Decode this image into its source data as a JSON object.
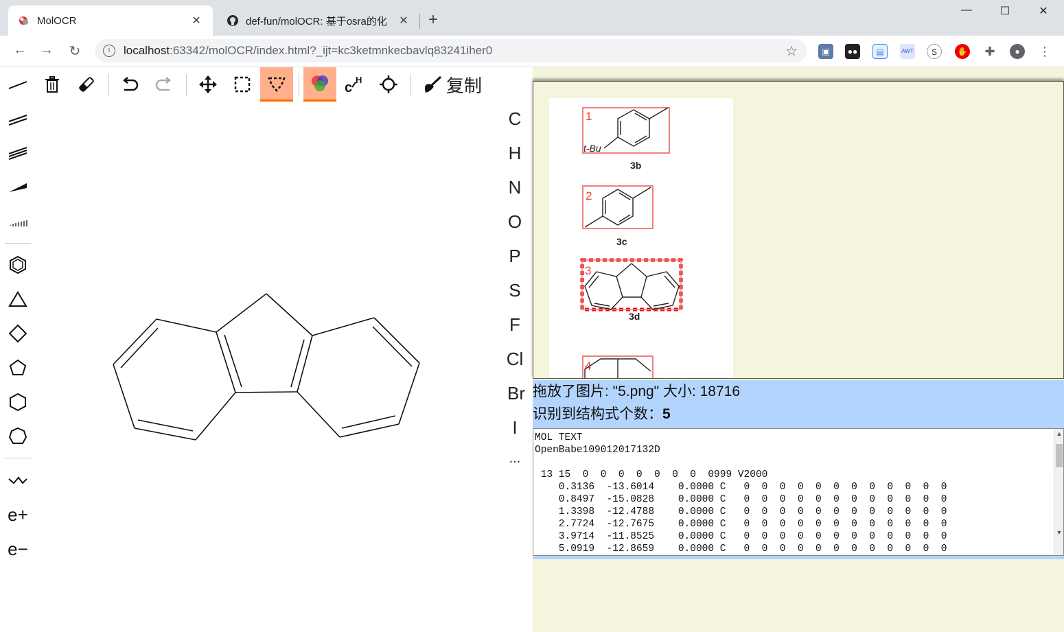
{
  "browser": {
    "tabs": [
      {
        "title": "MolOCR",
        "active": true
      },
      {
        "title": "def-fun/molOCR: 基于osra的化",
        "active": false
      }
    ],
    "address": {
      "host": "localhost",
      "rest": ":63342/molOCR/index.html?_ijt=kc3ketmnkecbavlq83241iher0"
    },
    "window_controls": [
      "—",
      "☐",
      "✕"
    ]
  },
  "toolbar": {
    "copy_label": "复制",
    "tools": [
      "delete-icon",
      "eraser-icon",
      "undo-icon",
      "redo-icon",
      "move-icon",
      "rect-select-icon",
      "lasso-select-icon",
      "color-icon",
      "hydrogen-icon",
      "center-icon",
      "clean-icon"
    ]
  },
  "left_tools": [
    "single-bond",
    "double-bond",
    "triple-bond",
    "wedge-bond",
    "hash-bond",
    "benzene",
    "cyclopropane",
    "cyclobutane",
    "cyclopentane",
    "cyclohexane",
    "cycloheptane",
    "chain",
    "positive-charge",
    "negative-charge"
  ],
  "charges": {
    "plus": "e+",
    "minus": "e−"
  },
  "atoms": [
    "C",
    "H",
    "N",
    "O",
    "P",
    "S",
    "F",
    "Cl",
    "Br",
    "I",
    "..."
  ],
  "image_panel": {
    "compounds": [
      {
        "index": "1",
        "label": "3b",
        "substituent": "t-Bu"
      },
      {
        "index": "2",
        "label": "3c"
      },
      {
        "index": "3",
        "label": "3d",
        "selected": true
      },
      {
        "index": "4",
        "label": ""
      }
    ]
  },
  "status": {
    "line1": "拖放了图片: \"5.png\" 大小: 18716",
    "line2_prefix": "识别到结构式个数：",
    "line2_count": "5"
  },
  "mol_text": "MOL TEXT\nOpenBabe109012017132D\n\n 13 15  0  0  0  0  0  0  0  0999 V2000\n    0.3136  -13.6014    0.0000 C   0  0  0  0  0  0  0  0  0  0  0  0\n    0.8497  -15.0828    0.0000 C   0  0  0  0  0  0  0  0  0  0  0  0\n    1.3398  -12.4788    0.0000 C   0  0  0  0  0  0  0  0  0  0  0  0\n    2.7724  -12.7675    0.0000 C   0  0  0  0  0  0  0  0  0  0  0  0\n    3.9714  -11.8525    0.0000 C   0  0  0  0  0  0  0  0  0  0  0  0\n    5.0919  -12.8659    0.0000 C   0  0  0  0  0  0  0  0  0  0  0  0"
}
